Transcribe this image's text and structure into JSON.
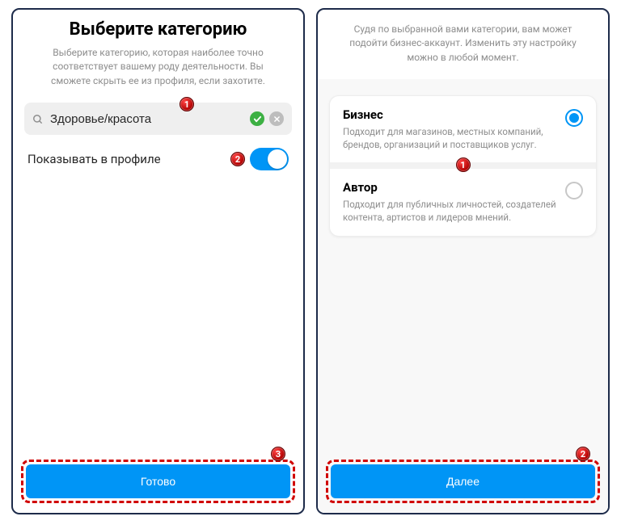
{
  "left": {
    "title": "Выберите категорию",
    "subtitle": "Выберите категорию, которая наиболее точно соответствует вашему роду деятельности. Вы сможете скрыть ее из профиля, если захотите.",
    "search_value": "Здоровье/красота",
    "toggle_label": "Показывать в профиле",
    "button_label": "Готово",
    "annotations": {
      "search": "1",
      "toggle": "2",
      "button": "3"
    }
  },
  "right": {
    "subtitle": "Судя по выбранной вами категории, вам может подойти бизнес-аккаунт. Изменить эту настройку можно в любой момент.",
    "options": [
      {
        "title": "Бизнес",
        "desc": "Подходит для магазинов, местных компаний, брендов, организаций и поставщиков услуг.",
        "selected": true
      },
      {
        "title": "Автор",
        "desc": "Подходит для публичных личностей, создателей контента, артистов и лидеров мнений.",
        "selected": false
      }
    ],
    "button_label": "Далее",
    "annotations": {
      "options": "1",
      "button": "2"
    }
  }
}
